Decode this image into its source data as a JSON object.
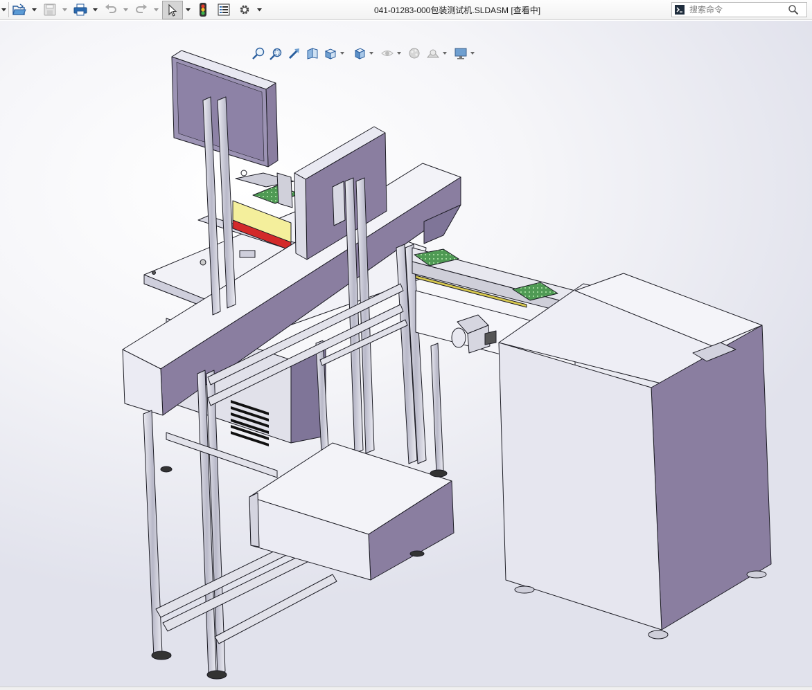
{
  "window": {
    "title": "041-01283-000包装测试机.SLDASM [查看中]"
  },
  "toolbar": {
    "items": [
      {
        "name": "open",
        "icon": "open-folder-icon"
      },
      {
        "name": "save",
        "icon": "save-icon",
        "disabled": true
      },
      {
        "name": "print",
        "icon": "print-icon"
      },
      {
        "name": "undo",
        "icon": "undo-icon",
        "disabled": true
      },
      {
        "name": "redo",
        "icon": "redo-icon",
        "disabled": true
      },
      {
        "name": "select",
        "icon": "pointer-icon",
        "active": true
      },
      {
        "name": "rebuild",
        "icon": "traffic-light-icon"
      },
      {
        "name": "file-properties",
        "icon": "properties-icon"
      },
      {
        "name": "options",
        "icon": "gear-icon"
      }
    ]
  },
  "search": {
    "placeholder": "搜索命令",
    "value": ""
  },
  "heads_up_toolbar": {
    "items": [
      {
        "name": "zoom-to-fit",
        "icon": "zoom-fit-icon"
      },
      {
        "name": "zoom-to-area",
        "icon": "zoom-area-icon"
      },
      {
        "name": "previous-view",
        "icon": "previous-view-icon"
      },
      {
        "name": "section-view",
        "icon": "section-view-icon"
      },
      {
        "name": "view-orientation",
        "icon": "view-orientation-icon"
      },
      {
        "name": "display-style",
        "icon": "display-style-icon"
      },
      {
        "name": "hide-show-items",
        "icon": "eye-icon"
      },
      {
        "name": "edit-appearance",
        "icon": "appearance-icon"
      },
      {
        "name": "apply-scene",
        "icon": "scene-icon"
      },
      {
        "name": "view-settings",
        "icon": "monitor-icon"
      }
    ]
  },
  "colors": {
    "part_face": "#e4e4f0",
    "part_shade": "#8a7ea0",
    "part_dark": "#6f6a86",
    "edge": "#1c1c24",
    "pcb_green": "#3fa34a",
    "rail_yellow": "#f2e38a",
    "rail_red": "#d32a2a",
    "frame": "#dcdce6"
  }
}
